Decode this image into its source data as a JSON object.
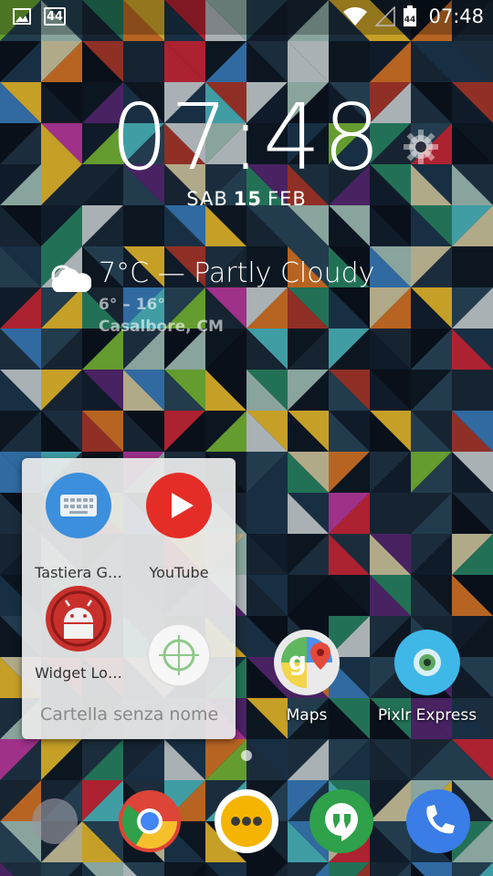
{
  "status_bar": {
    "time": "07:48",
    "notification_badge": "44",
    "icons": [
      "image-icon",
      "battery-44-icon",
      "wifi-icon",
      "signal-icon",
      "battery-icon"
    ]
  },
  "lockscreen": {
    "clock": "07:48",
    "date": {
      "day": "SAB",
      "num": "15",
      "month": "FEB"
    },
    "settings_icon": "gear-icon"
  },
  "weather": {
    "condition": "7°C — Partly Cloudy",
    "range": "6° – 16°",
    "location": "Casalbore, CM",
    "icon": "partly-cloudy-icon"
  },
  "folder": {
    "name": "Cartella senza nome",
    "apps": [
      {
        "label": "Tastiera G…",
        "icon": "keyboard-icon",
        "color": "#3b8fdc"
      },
      {
        "label": "YouTube",
        "icon": "youtube-play-icon",
        "color": "#e52d27"
      },
      {
        "label": "Widget Lo…",
        "icon": "android-icon",
        "color": "#c9302c"
      },
      {
        "label": "",
        "icon": "crosshair-icon",
        "color": "#ffffff"
      }
    ]
  },
  "home_apps": [
    {
      "label": "Maps",
      "icon": "maps-icon"
    },
    {
      "label": "Pixlr Express",
      "icon": "pixlr-icon"
    }
  ],
  "dock": [
    {
      "name": "app-drawer-icon"
    },
    {
      "name": "chrome-icon"
    },
    {
      "name": "all-apps-icon"
    },
    {
      "name": "hangouts-icon"
    },
    {
      "name": "phone-icon"
    }
  ]
}
